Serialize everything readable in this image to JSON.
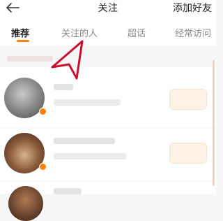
{
  "header": {
    "title": "关注",
    "add_friend_label": "添加好友",
    "back_icon": "arrow-left-icon"
  },
  "tabs": [
    {
      "label": "推荐",
      "active": true
    },
    {
      "label": "关注的人",
      "active": false
    },
    {
      "label": "超话",
      "active": false
    },
    {
      "label": "经常访问",
      "active": false
    }
  ],
  "colors": {
    "accent": "#ff8200",
    "annotation": "#c8102e"
  }
}
